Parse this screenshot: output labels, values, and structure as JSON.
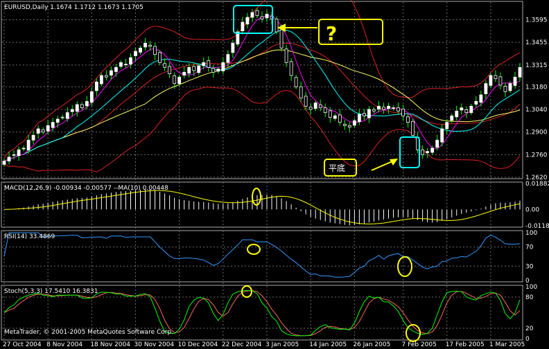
{
  "window": {
    "symbol_line": "EURUSD,Daily  1.1674 1.1712 1.1673 1.1705",
    "copyright": "MetaTrader, © 2001-2005 MetaQuotes Software Corp."
  },
  "annotations": {
    "question": "?",
    "bottom_label": "平底"
  },
  "colors": {
    "background": "#000000",
    "grid": "#6e6e6e",
    "candle_up": "#ffffff",
    "candle_down": "#ffffff",
    "wick": "#00ff00",
    "ma_fast": "#ff00ff",
    "ma_mid": "#00ffff",
    "ma_slow": "#ffff66",
    "envelope": "#dd2222",
    "macd_hist": "#ffffff",
    "macd_signal": "#ffff00",
    "rsi": "#3399ff",
    "stoch_main": "#00ff00",
    "stoch_signal": "#ff6666",
    "highlight_box": "#00ffff",
    "highlight_circle": "#ffff00"
  },
  "chart_data": [
    {
      "type": "candlestick",
      "name": "EURUSD,Daily",
      "x_ticks": [
        "27 Oct 2004",
        "8 Nov 2004",
        "18 Nov 2004",
        "30 Nov 2004",
        "10 Dec 2004",
        "22 Dec 2004",
        "3 Jan 2005",
        "14 Jan 2005",
        "26 Jan 2005",
        "7 Feb 2005",
        "17 Feb 2005",
        "1 Mar 2005"
      ],
      "y_ticks": [
        "1.3595",
        "1.3455",
        "1.3315",
        "1.3180",
        "1.3040",
        "1.2900",
        "1.2760",
        "1.2620"
      ],
      "ylim": [
        1.262,
        1.37
      ],
      "close": [
        1.272,
        1.2745,
        1.276,
        1.279,
        1.28,
        1.285,
        1.288,
        1.292,
        1.29,
        1.294,
        1.296,
        1.298,
        1.299,
        1.302,
        1.304,
        1.307,
        1.305,
        1.309,
        1.315,
        1.321,
        1.325,
        1.324,
        1.328,
        1.33,
        1.333,
        1.332,
        1.336,
        1.34,
        1.342,
        1.345,
        1.343,
        1.338,
        1.333,
        1.33,
        1.326,
        1.32,
        1.324,
        1.327,
        1.33,
        1.328,
        1.331,
        1.333,
        1.33,
        1.327,
        1.329,
        1.333,
        1.338,
        1.345,
        1.352,
        1.358,
        1.361,
        1.364,
        1.362,
        1.36,
        1.363,
        1.36,
        1.352,
        1.342,
        1.333,
        1.325,
        1.318,
        1.311,
        1.306,
        1.304,
        1.308,
        1.305,
        1.302,
        1.299,
        1.3,
        1.296,
        1.294,
        1.293,
        1.297,
        1.301,
        1.3,
        1.304,
        1.303,
        1.306,
        1.304,
        1.306,
        1.305,
        1.303,
        1.3,
        1.296,
        1.288,
        1.279,
        1.276,
        1.278,
        1.28,
        1.285,
        1.292,
        1.296,
        1.3,
        1.303,
        1.305,
        1.302,
        1.306,
        1.309,
        1.313,
        1.32,
        1.325,
        1.323,
        1.319,
        1.315,
        1.32,
        1.324,
        1.33
      ],
      "series": [
        {
          "name": "MA fast"
        },
        {
          "name": "MA mid"
        },
        {
          "name": "MA slow"
        },
        {
          "name": "Envelope upper"
        },
        {
          "name": "Envelope lower"
        }
      ]
    },
    {
      "type": "histogram",
      "name": "MACD(12,26,9) -0.00934 -0.00577 -- MA(10) -0.00448",
      "label": "MACD(12,26,9) -0.00934 -0.00577 --MA(10) 0.00448",
      "y_ticks": [
        "0.01882",
        "0.00",
        "-0.01187"
      ],
      "ylim": [
        -0.01187,
        0.01882
      ]
    },
    {
      "type": "line",
      "name": "RSI(14)",
      "label": "RSI(14) 33.4869",
      "y_ticks": [
        "100",
        "70",
        "30",
        "0"
      ],
      "ylim": [
        0,
        100
      ]
    },
    {
      "type": "line",
      "name": "Stoch(5,3,3)",
      "label": "Stoch(5,3,3) 17.5410 16.3831",
      "y_ticks": [
        "100",
        "80",
        "20",
        "0"
      ],
      "ylim": [
        0,
        100
      ]
    }
  ]
}
